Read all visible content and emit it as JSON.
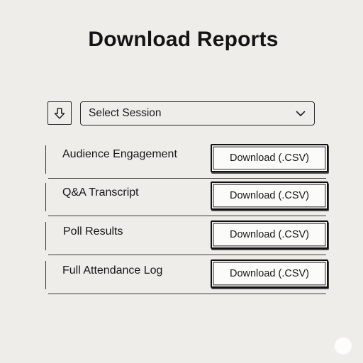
{
  "page": {
    "title": "Download Reports"
  },
  "session_select": {
    "selected": "Select Session",
    "chevron_icon": "chevron-down-icon"
  },
  "download_icon": "arrow-down-icon",
  "reports": [
    {
      "label": "Audience Engagement",
      "button_label": "Download (.CSV)"
    },
    {
      "label": "Q&A Transcript",
      "button_label": "Download (.CSV)"
    },
    {
      "label": "Poll Results",
      "button_label": "Download (.CSV)"
    },
    {
      "label": "Full Attendance Log",
      "button_label": "Download (.CSV)"
    }
  ]
}
